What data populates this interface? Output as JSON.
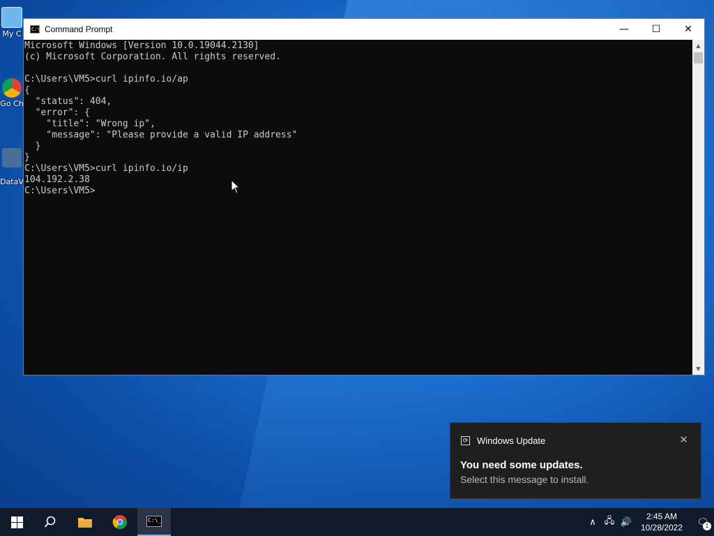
{
  "desktop": {
    "icons": [
      {
        "label": "My C",
        "name": "my-computer"
      },
      {
        "label": "Go Ch",
        "name": "google-chrome"
      },
      {
        "label": "DataV",
        "name": "datav"
      }
    ]
  },
  "window": {
    "title": "Command Prompt",
    "minimize_glyph": "—",
    "maximize_glyph": "☐",
    "close_glyph": "✕"
  },
  "console": {
    "lines": [
      "Microsoft Windows [Version 10.0.19044.2130]",
      "(c) Microsoft Corporation. All rights reserved.",
      "",
      "C:\\Users\\VM5>curl ipinfo.io/ap",
      "{",
      "  \"status\": 404,",
      "  \"error\": {",
      "    \"title\": \"Wrong ip\",",
      "    \"message\": \"Please provide a valid IP address\"",
      "  }",
      "}",
      "C:\\Users\\VM5>curl ipinfo.io/ip",
      "104.192.2.38",
      "C:\\Users\\VM5>"
    ]
  },
  "notification": {
    "app": "Windows Update",
    "title": "You need some updates.",
    "message": "Select this message to install.",
    "close_glyph": "✕"
  },
  "taskbar": {
    "time": "2:45 AM",
    "date": "10/28/2022",
    "notification_count": "1"
  },
  "colors": {
    "console_bg": "#0c0c0c",
    "console_text": "#cccccc",
    "taskbar_bg": "#101a2a",
    "toast_bg": "#1f1f1f"
  }
}
